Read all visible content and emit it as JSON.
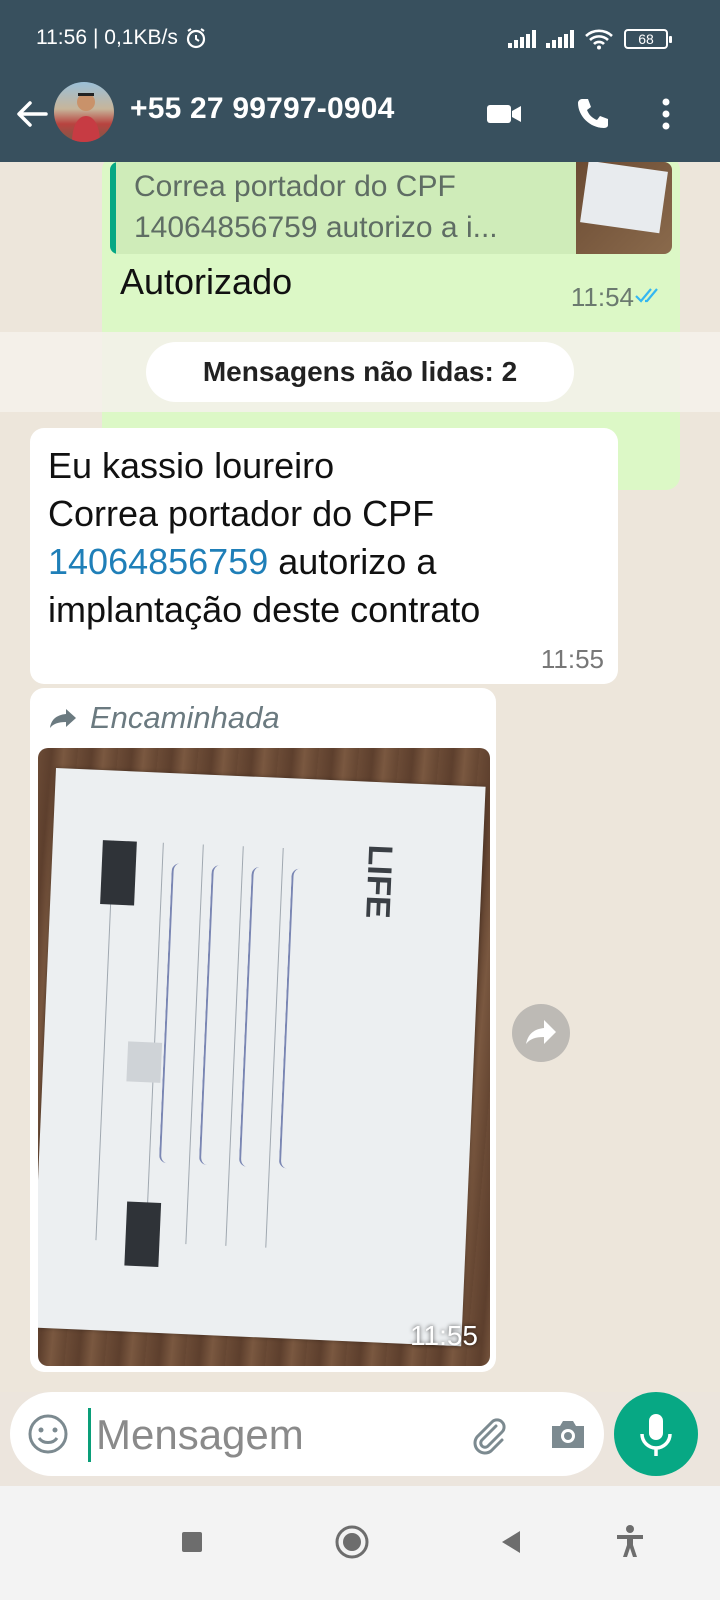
{
  "status_bar": {
    "time": "11:56",
    "network_speed": "| 0,1KB/s",
    "battery": "68",
    "icons": [
      "alarm-icon",
      "signal-icon",
      "signal-icon",
      "wifi-icon",
      "battery-icon"
    ]
  },
  "header": {
    "contact": "+55 27 99797-0904",
    "icons": [
      "back-arrow-icon",
      "video-call-icon",
      "phone-call-icon",
      "more-vert-icon"
    ]
  },
  "messages": {
    "outgoing": {
      "quote_text": "Correa portador do CPF 14064856759 autorizo a i...",
      "text": "Autorizado",
      "time": "11:54",
      "status_icon": "double-check-icon"
    },
    "unread_divider": "Mensagens não lidas: 2",
    "incoming_text": {
      "line1": "Eu kassio loureiro",
      "line2": "Correa portador do CPF",
      "cpf": "14064856759",
      "line3_rest": " autorizo a",
      "line4": "implantação deste contrato",
      "time": "11:55"
    },
    "incoming_forwarded": {
      "label": "Encaminhada",
      "image_content": "photo of a handwritten LIFE contract form",
      "image_logo_text": "LIFE",
      "time": "11:55"
    }
  },
  "composer": {
    "placeholder": "Mensagem",
    "icons": [
      "emoji-icon",
      "attach-icon",
      "camera-icon",
      "mic-icon"
    ]
  },
  "colors": {
    "header_bg": "#38505e",
    "outgoing_bubble": "#dcf8c6",
    "accent_green": "#07a884",
    "link_blue": "#1f7fb8",
    "chat_bg": "#ede6db"
  }
}
